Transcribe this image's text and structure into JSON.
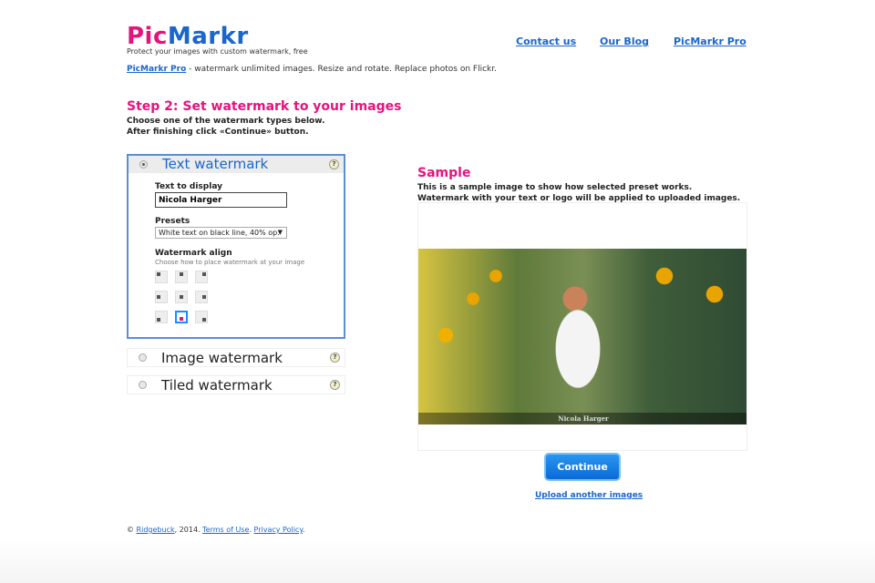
{
  "header": {
    "logo_pic": "Pic",
    "logo_markr": "Markr",
    "tagline": "Protect your images with custom watermark, free",
    "nav": [
      {
        "label": "Contact us"
      },
      {
        "label": "Our Blog"
      },
      {
        "label": "PicMarkr Pro"
      }
    ],
    "promo_link": "PicMarkr Pro",
    "promo_text": " - watermark unlimited images. Resize and rotate. Replace photos on Flickr."
  },
  "step": {
    "title": "Step 2: Set watermark to your images",
    "line1": "Choose one of the watermark types below.",
    "line2": "After finishing click «Continue» button."
  },
  "text_watermark": {
    "title": "Text watermark",
    "help": "?",
    "text_label": "Text to display",
    "text_value": "Nicola Harger",
    "presets_label": "Presets",
    "preset_value": "White text on black line, 40% op.",
    "align_label": "Watermark align",
    "align_hint": "Choose how to place watermark at your image",
    "align_selected": "bottom-center"
  },
  "options": [
    {
      "title": "Image watermark",
      "help": "?"
    },
    {
      "title": "Tiled watermark",
      "help": "?"
    }
  ],
  "sample": {
    "title": "Sample",
    "line1": "This is a sample image to show how selected preset works.",
    "line2": "Watermark with your text or logo will be applied to uploaded images.",
    "watermark_text": "Nicola Harger"
  },
  "actions": {
    "continue": "Continue",
    "upload": "Upload another images"
  },
  "footer": {
    "copy": "© ",
    "ridgebuck": "Ridgebuck",
    "year": ", 2014. ",
    "terms": "Terms of Use",
    "sep": ". ",
    "privacy": "Privacy Policy",
    "end": "."
  }
}
